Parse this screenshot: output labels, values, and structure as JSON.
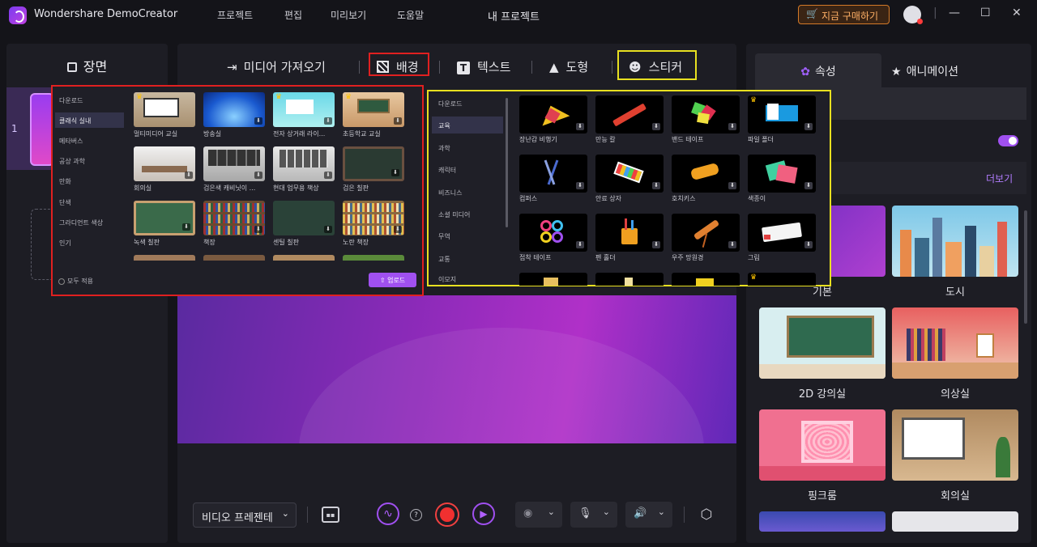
{
  "app": {
    "name": "Wondershare DemoCreator",
    "project_title": "내 프로젝트",
    "buy_label": "지금 구매하기"
  },
  "menu": [
    "프로젝트",
    "편집",
    "미리보기",
    "도움말"
  ],
  "window_controls": {
    "minimize": "—",
    "maximize": "☐",
    "close": "✕",
    "divider": "|"
  },
  "left": {
    "title": "장면",
    "scene_number": "1"
  },
  "center_tabs": {
    "import": "미디어 가져오기",
    "background": "배경",
    "text": "텍스트",
    "shape": "도형",
    "sticker": "스티커"
  },
  "bg_popup": {
    "categories": [
      "다운로드",
      "클래식 실내",
      "메타버스",
      "공상 과학",
      "만화",
      "단색",
      "그라디언트 색상",
      "인기"
    ],
    "selected_category": "클래식 실내",
    "items": [
      {
        "label": "멀티미디어 교실",
        "premium": true
      },
      {
        "label": "방송실",
        "premium": false
      },
      {
        "label": "전자 상거래 라이...",
        "premium": true
      },
      {
        "label": "초등학교 교실",
        "premium": true
      },
      {
        "label": "회의실",
        "premium": false
      },
      {
        "label": "검은색 캐비닛이 ...",
        "premium": false
      },
      {
        "label": "현대 업무용 책상",
        "premium": false
      },
      {
        "label": "검은 칠판",
        "premium": false
      },
      {
        "label": "녹색 칠판",
        "premium": false
      },
      {
        "label": "책장",
        "premium": false
      },
      {
        "label": "센틸 칠판",
        "premium": false
      },
      {
        "label": "노란 책장",
        "premium": false
      }
    ],
    "apply_all": "모두 적용",
    "upload": "업로드"
  },
  "sticker_popup": {
    "categories": [
      "다운로드",
      "교육",
      "과학",
      "캐릭터",
      "비즈니스",
      "소셜 미디어",
      "무역",
      "교통",
      "이모지"
    ],
    "selected_category": "교육",
    "items": [
      {
        "label": "장난감 비행기",
        "premium": false
      },
      {
        "label": "만능 칼",
        "premium": false
      },
      {
        "label": "밴드 테이프",
        "premium": false
      },
      {
        "label": "파일 폴더",
        "premium": true
      },
      {
        "label": "컴퍼스",
        "premium": false
      },
      {
        "label": "안료 상자",
        "premium": false
      },
      {
        "label": "호치키스",
        "premium": false
      },
      {
        "label": "색종이",
        "premium": false
      },
      {
        "label": "접착 테이프",
        "premium": false
      },
      {
        "label": "펜 홀더",
        "premium": false
      },
      {
        "label": "우주 망원경",
        "premium": false
      },
      {
        "label": "그림",
        "premium": false
      }
    ]
  },
  "toolbar": {
    "mode": "비디오 프레젠테",
    "help": "?"
  },
  "right": {
    "tab_props": "속성",
    "tab_anim": "애니메이션",
    "more": "더보기",
    "items": [
      {
        "label": "기본"
      },
      {
        "label": "도시"
      },
      {
        "label": "2D 강의실"
      },
      {
        "label": "의상실"
      },
      {
        "label": "핑크룸"
      },
      {
        "label": "회의실"
      }
    ]
  },
  "colors": {
    "accent": "#a050f0",
    "highlight_red": "#e02020",
    "highlight_yellow": "#e8e020",
    "buy": "#ffb066"
  }
}
